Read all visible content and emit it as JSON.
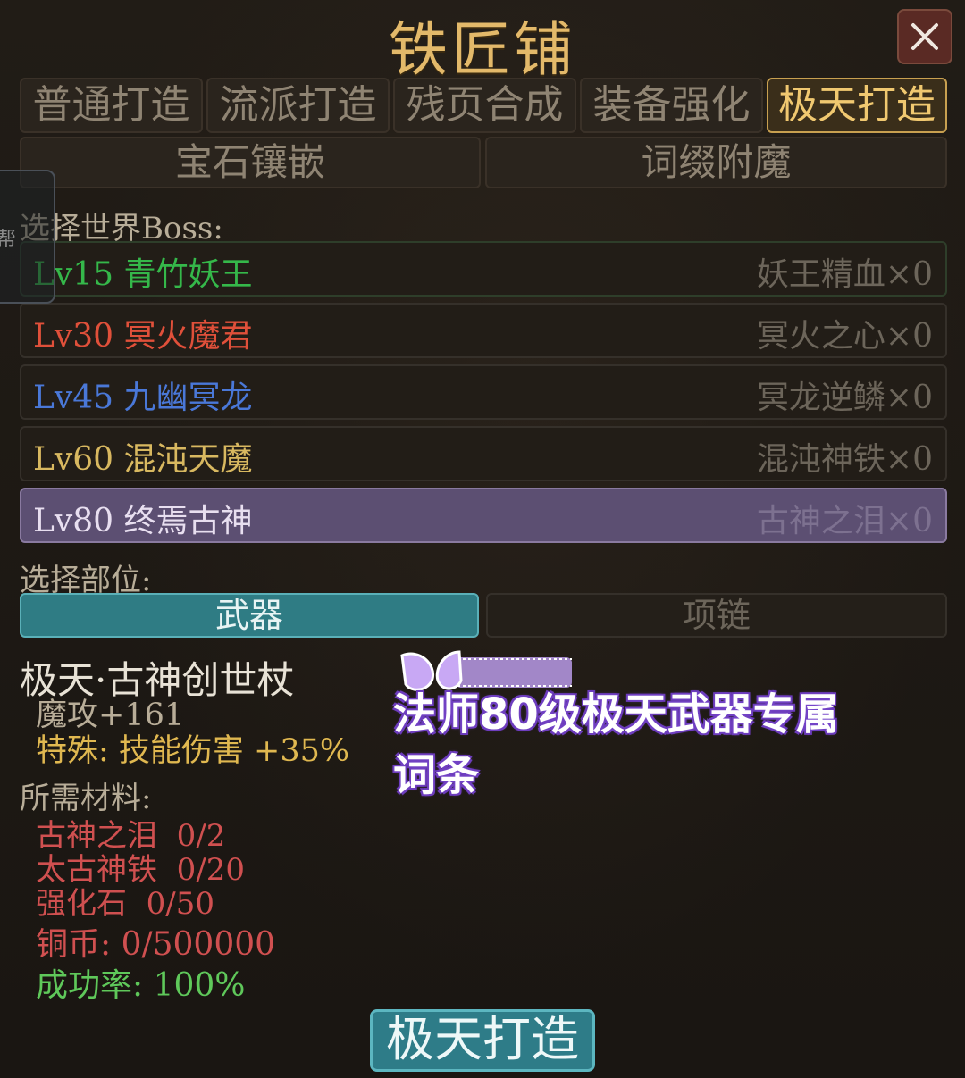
{
  "window": {
    "title": "铁匠铺",
    "close_icon": "close-icon"
  },
  "tabs": [
    {
      "label": "普通打造",
      "active": false
    },
    {
      "label": "流派打造",
      "active": false
    },
    {
      "label": "残页合成",
      "active": false
    },
    {
      "label": "装备强化",
      "active": false
    },
    {
      "label": "极天打造",
      "active": true
    }
  ],
  "subtabs": [
    {
      "label": "宝石镶嵌"
    },
    {
      "label": "词缀附魔"
    }
  ],
  "side_handle": {
    "label": "帮"
  },
  "boss_section": {
    "label": "选择世界Boss:",
    "bosses": [
      {
        "name": "Lv15 青竹妖王",
        "material": "妖王精血×0",
        "color": "#35b84a"
      },
      {
        "name": "Lv30 冥火魔君",
        "material": "冥火之心×0",
        "color": "#e0503a"
      },
      {
        "name": "Lv45 九幽冥龙",
        "material": "冥龙逆鳞×0",
        "color": "#4a78d8"
      },
      {
        "name": "Lv60 混沌天魔",
        "material": "混沌神铁×0",
        "color": "#d8b860"
      },
      {
        "name": "Lv80 终焉古神",
        "material": "古神之泪×0",
        "color": "#e8dff0",
        "selected": true
      }
    ]
  },
  "part_section": {
    "label": "选择部位:",
    "parts": [
      {
        "label": "武器",
        "active": true
      },
      {
        "label": "项链",
        "active": false
      }
    ]
  },
  "item": {
    "name": "极天·古神创世杖",
    "stat_main": "魔攻+161",
    "stat_special": "特殊: 技能伤害 +35%"
  },
  "materials": {
    "label": "所需材料:",
    "list": [
      {
        "name": "古神之泪",
        "amount": "0/2"
      },
      {
        "name": "太古神铁",
        "amount": "0/20"
      },
      {
        "name": "强化石",
        "amount": "0/50"
      }
    ],
    "coins": "铜币: 0/500000",
    "success_rate": "成功率: 100%"
  },
  "overlay_caption": {
    "line1": "法师80级极天武器专属",
    "line2": "词条"
  },
  "forge_button": {
    "label": "极天打造"
  },
  "colors": {
    "title": "#e3b96a",
    "active_tab": "#f0c870",
    "accent_teal": "#2f7c84",
    "selected_row": "#5c4f72",
    "material_red": "#d05050",
    "success_green": "#5fc85a",
    "special_gold": "#e0b850"
  }
}
